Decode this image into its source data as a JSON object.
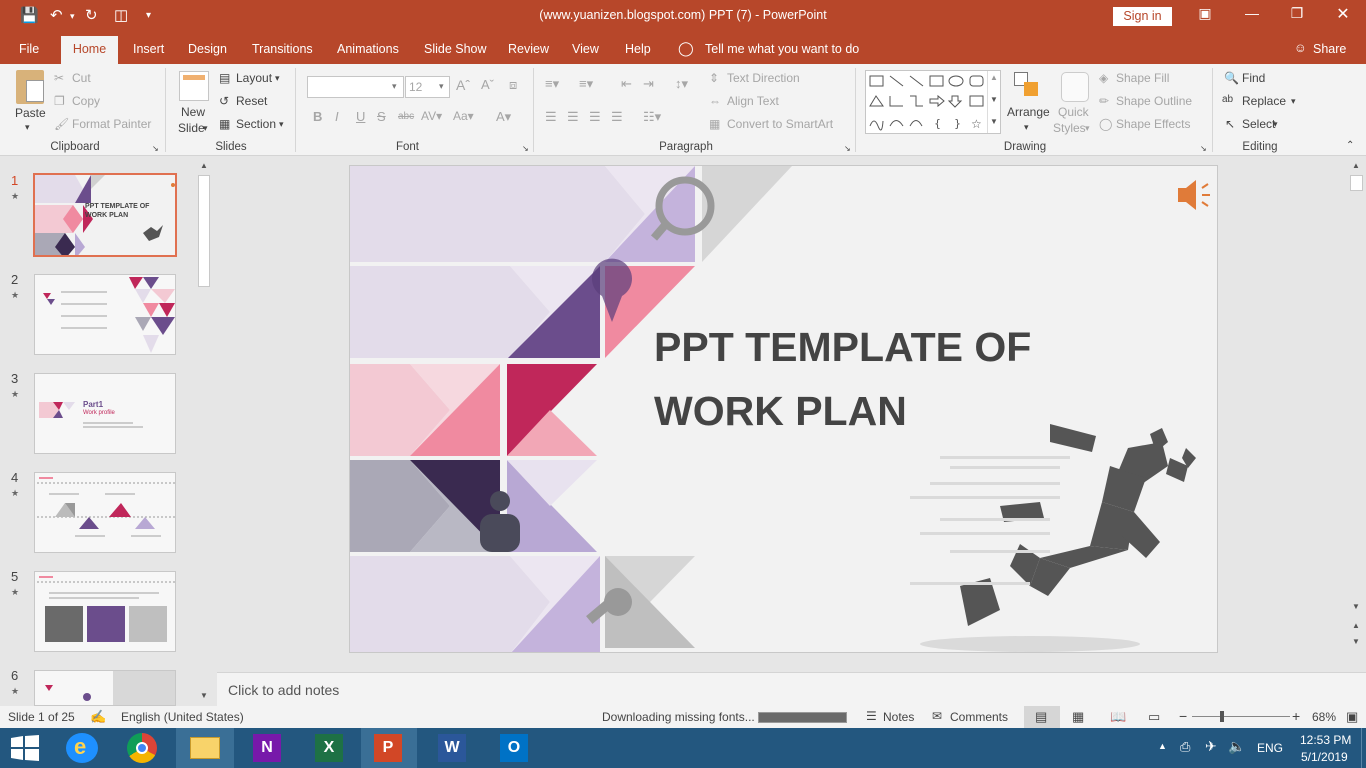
{
  "window": {
    "title": "(www.yuanizen.blogspot.com) PPT (7)  -  PowerPoint",
    "signin": "Sign in"
  },
  "tabs": [
    {
      "label": "File"
    },
    {
      "label": "Home"
    },
    {
      "label": "Insert"
    },
    {
      "label": "Design"
    },
    {
      "label": "Transitions"
    },
    {
      "label": "Animations"
    },
    {
      "label": "Slide Show"
    },
    {
      "label": "Review"
    },
    {
      "label": "View"
    },
    {
      "label": "Help"
    }
  ],
  "tell_me": "Tell me what you want to do",
  "share": "Share",
  "ribbon": {
    "clipboard": {
      "paste": "Paste",
      "cut": "Cut",
      "copy": "Copy",
      "format_painter": "Format Painter",
      "group": "Clipboard"
    },
    "slides": {
      "new_slide_1": "New",
      "new_slide_2": "Slide",
      "layout": "Layout",
      "reset": "Reset",
      "section": "Section",
      "group": "Slides"
    },
    "font": {
      "font_name": "",
      "font_size": "12",
      "group": "Font"
    },
    "paragraph": {
      "text_direction": "Text Direction",
      "align_text": "Align Text",
      "convert_smartart": "Convert to SmartArt",
      "group": "Paragraph"
    },
    "drawing": {
      "arrange": "Arrange",
      "quick_styles_1": "Quick",
      "quick_styles_2": "Styles",
      "shape_fill": "Shape Fill",
      "shape_outline": "Shape Outline",
      "shape_effects": "Shape Effects",
      "group": "Drawing"
    },
    "editing": {
      "find": "Find",
      "replace": "Replace",
      "select": "Select",
      "group": "Editing"
    }
  },
  "thumbnails": [
    {
      "num": "1",
      "title_line1": "PPT TEMPLATE OF",
      "title_line2": "WORK PLAN"
    },
    {
      "num": "2"
    },
    {
      "num": "3",
      "part": "Part1",
      "sub": "Work profile"
    },
    {
      "num": "4"
    },
    {
      "num": "5"
    },
    {
      "num": "6"
    }
  ],
  "slide": {
    "title_line1": "PPT TEMPLATE OF",
    "title_line2": "WORK PLAN"
  },
  "notes_placeholder": "Click to add notes",
  "status": {
    "slide_of": "Slide 1 of 25",
    "language": "English (United States)",
    "downloading": "Downloading missing fonts...",
    "download_progress": 1.0,
    "notes": "Notes",
    "comments": "Comments",
    "zoom": "68%"
  },
  "taskbar": {
    "lang": "ENG",
    "time": "12:53 PM",
    "date": "5/1/2019"
  },
  "colors": {
    "accent": "#b7472a",
    "taskbar": "#23577f"
  }
}
